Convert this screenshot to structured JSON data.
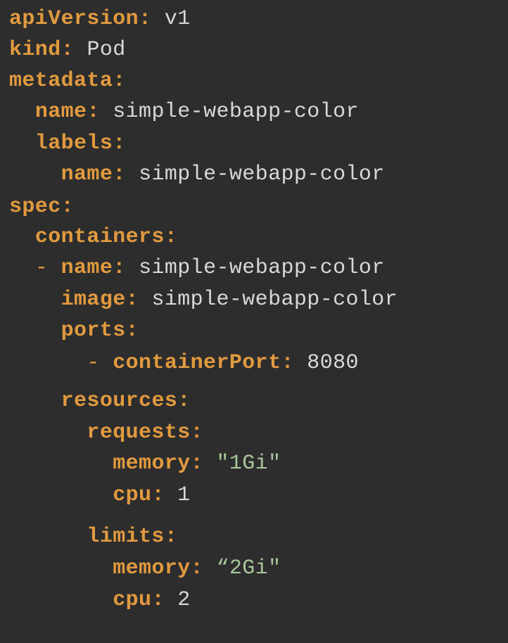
{
  "colors": {
    "background": "#2d2d2d",
    "key": "#e19a3f",
    "value": "#d8d8d8",
    "string": "#a8c79b"
  },
  "lines": [
    {
      "indent": "",
      "dash": "",
      "key": "apiVersion",
      "value": "v1"
    },
    {
      "indent": "",
      "dash": "",
      "key": "kind",
      "value": "Pod"
    },
    {
      "indent": "",
      "dash": "",
      "key": "metadata",
      "value": ""
    },
    {
      "indent": "  ",
      "dash": "",
      "key": "name",
      "value": "simple-webapp-color"
    },
    {
      "indent": "  ",
      "dash": "",
      "key": "labels",
      "value": ""
    },
    {
      "indent": "    ",
      "dash": "",
      "key": "name",
      "value": "simple-webapp-color"
    },
    {
      "indent": "",
      "dash": "",
      "key": "spec",
      "value": ""
    },
    {
      "indent": "  ",
      "dash": "",
      "key": "containers",
      "value": ""
    },
    {
      "indent": "  ",
      "dash": "- ",
      "key": "name",
      "value": "simple-webapp-color"
    },
    {
      "indent": "    ",
      "dash": "",
      "key": "image",
      "value": "simple-webapp-color"
    },
    {
      "indent": "    ",
      "dash": "",
      "key": "ports",
      "value": ""
    },
    {
      "indent": "      ",
      "dash": "- ",
      "key": "containerPort",
      "value": "8080"
    },
    {
      "indent": "    ",
      "dash": "",
      "key": "resources",
      "value": ""
    },
    {
      "indent": "      ",
      "dash": "",
      "key": "requests",
      "value": ""
    },
    {
      "indent": "        ",
      "dash": "",
      "key": "memory",
      "value": "\"1Gi\""
    },
    {
      "indent": "        ",
      "dash": "",
      "key": "cpu",
      "value": "1"
    },
    {
      "indent": "      ",
      "dash": "",
      "key": "limits",
      "value": ""
    },
    {
      "indent": "        ",
      "dash": "",
      "key": "memory",
      "value": "“2Gi\""
    },
    {
      "indent": "        ",
      "dash": "",
      "key": "cpu",
      "value": "2"
    }
  ]
}
